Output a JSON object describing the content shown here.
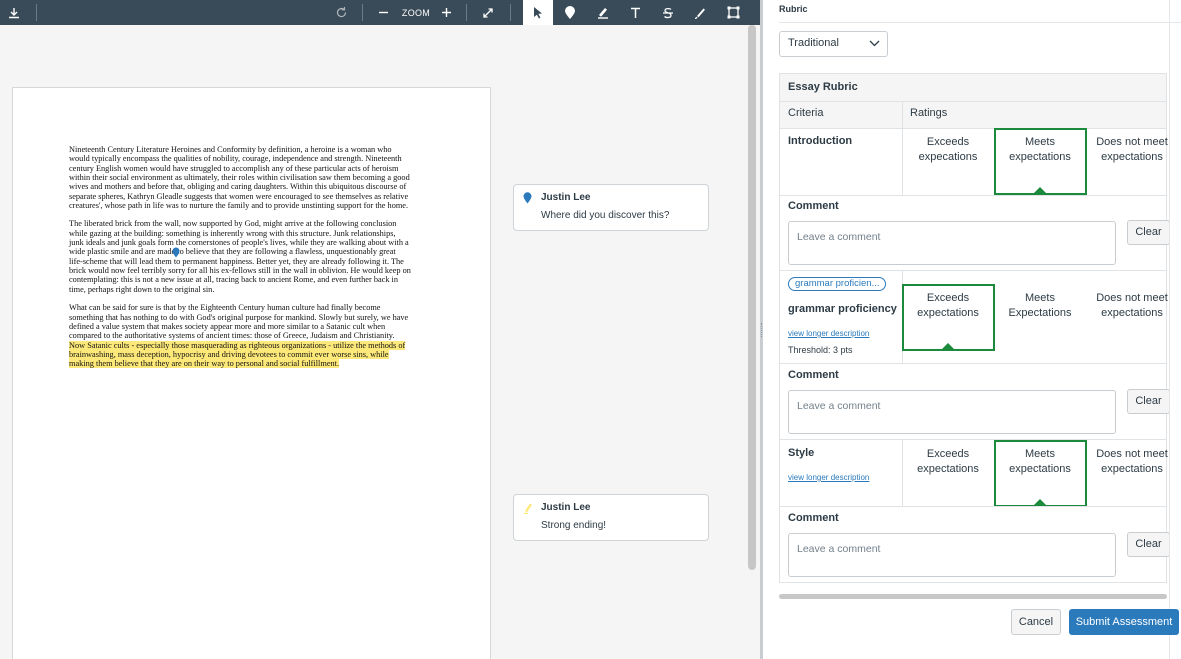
{
  "toolbar": {
    "zoom_label": "ZOOM",
    "tools": [
      "download-icon",
      "rotate-icon",
      "zoom-out-icon",
      "zoom-in-icon",
      "fullscreen-icon",
      "select-icon",
      "point-annotation-icon",
      "highlight-icon",
      "text-icon",
      "strikeout-icon",
      "freedraw-icon",
      "area-icon"
    ],
    "background": "#394b58"
  },
  "document": {
    "paragraphs": [
      "Nineteenth Century Literature Heroines and Conformity by definition, a heroine is a woman who would typically encompass the qualities of nobility, courage, independence and strength. Nineteenth century English women would have struggled to accomplish any of these particular acts of heroism within their social environment as ultimately, their roles within civilisation saw them becoming a good wives and mothers and before that, obliging and caring daughters. Within this ubiquitous discourse of separate spheres, Kathryn Gleadle suggests that women were encouraged to see themselves as relative creatures', whose path in life was to nurture the family and to provide unstinting support for the home.",
      "The liberated brick from the wall, now supported by God, might arrive at the following conclusion while gazing at the building: something is inherently wrong with this structure. Junk relationships, junk ideals and junk goals form the cornerstones of people's lives, while they are walking about with a wide plastic smile and are made to believe that they are following a flawless, unquestionably great life-scheme that will lead them to permanent happiness. Better yet, they are already following it. The brick would now feel terribly sorry for all his ex-fellows still in the wall in oblivion. He would keep on contemplating: this is not a new issue at all, tracing back to ancient Rome, and even further back in time, perhaps right down to the original sin."
    ],
    "last_paragraph_plain": "What can be said for sure is that by the Eighteenth Century human culture had finally become something that has nothing to do with God's original purpose for mankind. Slowly but surely, we have defined a value system that makes society appear more and more similar to a Satanic cult when compared to the authoritative systems of ancient times: those of Greece, Judaism and Christianity.",
    "last_paragraph_highlighted": "Now Satanic cults - especially those masquerading as righteous organizations - utilize the methods of brainwashing, mass deception, hypocrisy and driving devotees to commit ever worse sins, while making them believe that they are on their way to personal and social fulfillment.",
    "highlight_color": "#fde97a"
  },
  "annotations": [
    {
      "icon": "map-pin-icon",
      "author": "Justin Lee",
      "text": "Where did you discover this?"
    },
    {
      "icon": "highlighter-icon",
      "author": "Justin Lee",
      "text": "Strong ending!"
    }
  ],
  "rubric": {
    "title": "Rubric",
    "type_selected": "Traditional",
    "name": "Essay Rubric",
    "col_criteria": "Criteria",
    "col_ratings": "Ratings",
    "comment_label": "Comment",
    "comment_placeholder": "Leave a comment",
    "clear_label": "Clear",
    "criteria": [
      {
        "name": "Introduction",
        "ratings": [
          "Exceeds expecations",
          "Meets expectations",
          "Does not meet expectations"
        ],
        "selected_rating": 1
      },
      {
        "outcome_tag": "grammar proficien...",
        "name": "grammar proficiency",
        "link": "view longer description",
        "threshold": "Threshold: 3 pts",
        "ratings": [
          "Exceeds expectations",
          "Meets Expectations",
          "Does not meet expectations"
        ],
        "selected_rating": 0
      },
      {
        "name": "Style",
        "link": "view longer description",
        "ratings": [
          "Exceeds expectations",
          "Meets expectations",
          "Does not meet expectations"
        ],
        "selected_rating": 1
      }
    ],
    "selected_color": "#1c8a3c"
  },
  "footer": {
    "cancel_label": "Cancel",
    "submit_label": "Submit Assessment",
    "submit_color": "#2b7abc"
  }
}
